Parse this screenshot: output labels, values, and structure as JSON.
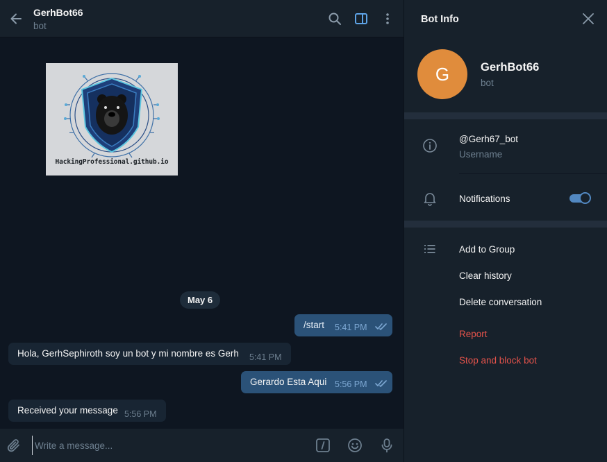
{
  "chat": {
    "name": "GerhBot66",
    "status": "bot",
    "image_caption": "HackingProfessional.github.io",
    "date_label": "May 6",
    "messages": [
      {
        "text": "/start",
        "time": "5:41 PM",
        "direction": "out"
      },
      {
        "text": "Hola, GerhSephiroth soy un bot y mi nombre es Gerh",
        "time": "5:41 PM",
        "direction": "in"
      },
      {
        "text": "Gerardo Esta Aqui",
        "time": "5:56 PM",
        "direction": "out"
      },
      {
        "text": "Received your message",
        "time": "5:56 PM",
        "direction": "in"
      }
    ],
    "composer_placeholder": "Write a message..."
  },
  "info": {
    "title": "Bot Info",
    "avatar_letter": "G",
    "name": "GerhBot66",
    "status": "bot",
    "username": "@Gerh67_bot",
    "username_label": "Username",
    "notifications_label": "Notifications",
    "notifications_on": true,
    "actions": [
      "Add to Group",
      "Clear history",
      "Delete conversation"
    ],
    "danger_actions": [
      "Report",
      "Stop and block bot"
    ]
  },
  "colors": {
    "background": "#0e1621",
    "panel": "#17212b",
    "outgoing_bubble": "#2b5278",
    "incoming_bubble": "#182533",
    "accent": "#5288c1",
    "avatar": "#e08c3c",
    "danger": "#e5534b"
  },
  "icons": [
    "back-arrow-icon",
    "search-icon",
    "side-panel-icon",
    "more-vertical-icon",
    "double-check-icon",
    "paperclip-icon",
    "slash-command-icon",
    "emoji-icon",
    "microphone-icon",
    "close-icon",
    "info-icon",
    "bell-icon",
    "list-icon"
  ]
}
